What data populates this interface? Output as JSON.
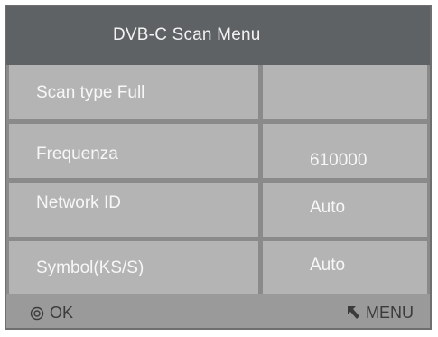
{
  "menu": {
    "title": "DVB-C Scan Menu"
  },
  "rows": [
    {
      "label": "Scan type Full",
      "value": ""
    },
    {
      "label": "Frequenza",
      "value": "610000"
    },
    {
      "label": "Network ID",
      "value": "Auto"
    },
    {
      "label": "Symbol(KS/S)",
      "value": "Auto"
    }
  ],
  "footer": {
    "ok_label": "OK",
    "menu_label": "MENU",
    "ok_icon": "ok-circle-icon",
    "menu_icon": "menu-arrow-icon"
  },
  "colors": {
    "header_bg": "#5f6264",
    "cell_bg": "#b4b4b4",
    "grid_lines": "#8a8a8a",
    "footer_bg": "#9a9a9a"
  }
}
